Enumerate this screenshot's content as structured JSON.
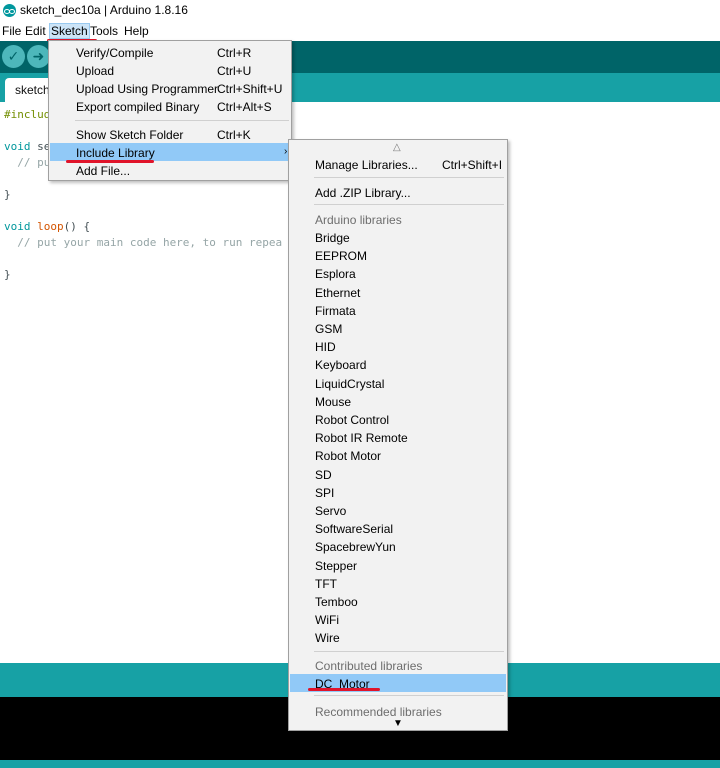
{
  "window": {
    "title": "sketch_dec10a | Arduino 1.8.16"
  },
  "menubar": {
    "file": "File",
    "edit": "Edit",
    "sketch": "Sketch",
    "tools": "Tools",
    "help": "Help"
  },
  "toolbar": {
    "verify_icon": "checkmark-icon",
    "upload_icon": "arrow-right-icon"
  },
  "tab": {
    "label": "sketch"
  },
  "code": {
    "line1": "#includ",
    "line3_kw": "void",
    "line3_rest": " se",
    "line4": "  // pu",
    "line6": "}",
    "line8_kw": "void",
    "line8_fn": " loop",
    "line8_rest": "() {",
    "line9": "  // put your main code here, to run repea",
    "line11": "}"
  },
  "sketch_menu": {
    "items": [
      {
        "label": "Verify/Compile",
        "shortcut": "Ctrl+R"
      },
      {
        "label": "Upload",
        "shortcut": "Ctrl+U"
      },
      {
        "label": "Upload Using Programmer",
        "shortcut": "Ctrl+Shift+U"
      },
      {
        "label": "Export compiled Binary",
        "shortcut": "Ctrl+Alt+S"
      },
      {
        "label": "Show Sketch Folder",
        "shortcut": "Ctrl+K"
      },
      {
        "label": "Include Library",
        "shortcut": ""
      },
      {
        "label": "Add File...",
        "shortcut": ""
      }
    ],
    "submenu_arrow": "›"
  },
  "library_menu": {
    "scroll_up": "△",
    "scroll_down": "▼",
    "manage": {
      "label": "Manage Libraries...",
      "shortcut": "Ctrl+Shift+I"
    },
    "add_zip": "Add .ZIP Library...",
    "arduino_header": "Arduino libraries",
    "arduino_libraries": [
      "Bridge",
      "EEPROM",
      "Esplora",
      "Ethernet",
      "Firmata",
      "GSM",
      "HID",
      "Keyboard",
      "LiquidCrystal",
      "Mouse",
      "Robot Control",
      "Robot IR Remote",
      "Robot Motor",
      "SD",
      "SPI",
      "Servo",
      "SoftwareSerial",
      "SpacebrewYun",
      "Stepper",
      "TFT",
      "Temboo",
      "WiFi",
      "Wire"
    ],
    "contributed_header": "Contributed libraries",
    "contributed_libraries": [
      "DC_Motor"
    ],
    "recommended_header": "Recommended libraries"
  },
  "colors": {
    "toolbar": "#006468",
    "tabstrip": "#17a1a5",
    "highlight": "#91c9f7",
    "annotation": "#e0142a"
  }
}
